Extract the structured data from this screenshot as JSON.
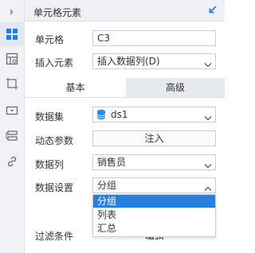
{
  "sidebar": {
    "items": [
      {
        "name": "expand-arrow-icon"
      },
      {
        "name": "cell-element-icon",
        "active": true
      },
      {
        "name": "cell-attribute-icon"
      },
      {
        "name": "cell-style-icon"
      },
      {
        "name": "widget-icon"
      },
      {
        "name": "condition-attribute-icon"
      },
      {
        "name": "hyperlink-icon"
      }
    ]
  },
  "header": {
    "title": "单元格元素",
    "collapse_icon": "collapse-arrow-icon"
  },
  "cell": {
    "label": "单元格",
    "value": "C3"
  },
  "insert": {
    "label": "插入元素",
    "value": "插入数据列(D)"
  },
  "tabs": {
    "basic": "基本",
    "advanced": "高级",
    "active": "basic"
  },
  "dataset": {
    "label": "数据集",
    "value": "ds1",
    "icon": "database-icon"
  },
  "dynamic_param": {
    "label": "动态参数",
    "button": "注入"
  },
  "data_column": {
    "label": "数据列",
    "value": "销售员"
  },
  "data_setting": {
    "label": "数据设置",
    "value": "分组",
    "options": [
      "分组",
      "列表",
      "汇总"
    ],
    "selected_index": 0
  },
  "filter": {
    "label": "过滤条件",
    "partial_button": "编辑"
  },
  "colors": {
    "accent": "#2a7fda",
    "tab_inactive": "#e6e9ee",
    "database_icon": "#2d8de6"
  }
}
